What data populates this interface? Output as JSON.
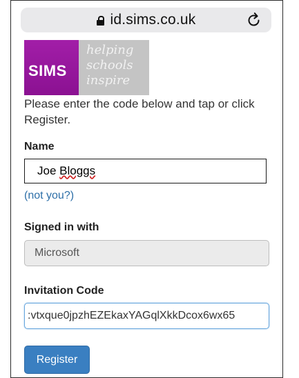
{
  "browser": {
    "url": "id.sims.co.uk",
    "lock_icon": "lock-icon",
    "reload_icon": "reload-icon"
  },
  "logo": {
    "brand": "SIMS",
    "tagline": [
      "helping",
      "schools",
      "inspire"
    ],
    "brand_color": "#9b1aa0",
    "tagline_bg": "#c4c4c4"
  },
  "form": {
    "instructions": "Please enter the code below and tap or click Register.",
    "name_label": "Name",
    "name_first": "Joe ",
    "name_last": "Bloggs",
    "not_you": "(not you?)",
    "signed_in_label": "Signed in with",
    "signed_in_value": "Microsoft",
    "invitation_label": "Invitation Code",
    "invitation_value": ":vtxque0jpzhEZEkaxYAGqlXkkDcox6wx65",
    "register_label": "Register"
  },
  "colors": {
    "accent": "#3a7fc1",
    "link": "#2d6fa8",
    "focus_border": "#66a5dd"
  }
}
